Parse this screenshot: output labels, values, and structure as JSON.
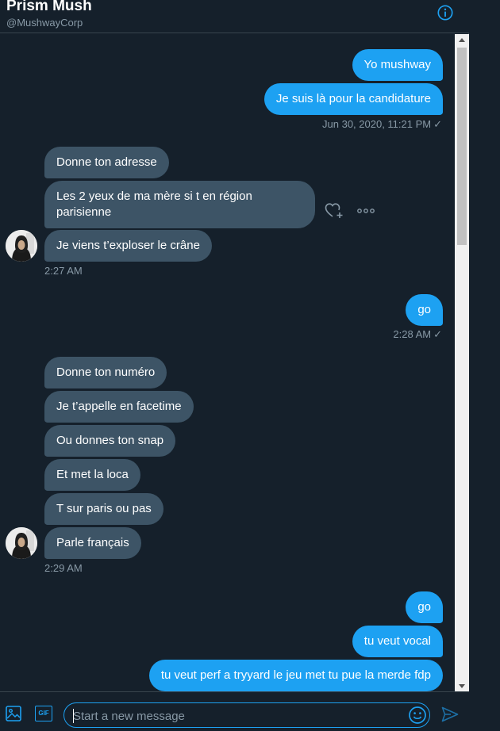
{
  "header": {
    "title": "Prism Mush",
    "handle": "@MushwayCorp",
    "info_icon": "info-icon"
  },
  "messages": {
    "group1": {
      "sent": [
        "Yo mushway",
        "Je suis là pour la candidature"
      ],
      "timestamp": "Jun 30, 2020, 11:21 PM"
    },
    "group2": {
      "received": [
        "Donne ton adresse",
        "Les 2 yeux de ma mère si t en région parisienne",
        "Je viens t’exploser le crâne"
      ],
      "timestamp": "2:27 AM"
    },
    "group3": {
      "sent": [
        "go"
      ],
      "timestamp": "2:28 AM"
    },
    "group4": {
      "received": [
        "Donne ton numéro",
        "Je t’appelle en facetime",
        "Ou donnes ton snap",
        "Et met la loca",
        "T sur paris ou pas",
        "Parle français"
      ],
      "timestamp": "2:29 AM"
    },
    "group5": {
      "sent": [
        "go",
        "tu veut vocal",
        "tu veut perf a tryyard le jeu met tu pue la merde fdp"
      ]
    },
    "read_mark": "✓"
  },
  "composer": {
    "placeholder": "Start a new message",
    "value": "",
    "gif_label": "GIF"
  },
  "colors": {
    "background": "#15202b",
    "sent_bubble": "#1da1f2",
    "received_bubble": "#3d5466",
    "muted_text": "#8899a6",
    "accent": "#1da1f2",
    "border": "#38444d"
  }
}
